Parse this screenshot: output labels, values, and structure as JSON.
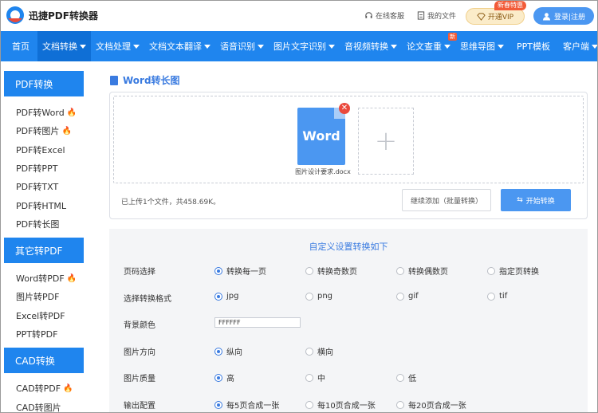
{
  "brand": {
    "name": "迅捷PDF转换器"
  },
  "header": {
    "online_service": "在线客服",
    "my_files": "我的文件",
    "vip_label": "开通VIP",
    "vip_badge": "新春特惠",
    "login_label": "登录|注册"
  },
  "nav": {
    "items": [
      "首页",
      "文档转换",
      "文档处理",
      "文档文本翻译",
      "语音识别",
      "图片文字识别",
      "音视频转换",
      "论文查重",
      "思维导图",
      "PPT模板",
      "客户端"
    ],
    "new_badge": "新"
  },
  "sidebar": {
    "groups": [
      {
        "title": "PDF转换",
        "items": [
          "PDF转Word",
          "PDF转图片",
          "PDF转Excel",
          "PDF转PPT",
          "PDF转TXT",
          "PDF转HTML",
          "PDF转长图"
        ]
      },
      {
        "title": "其它转PDF",
        "items": [
          "Word转PDF",
          "图片转PDF",
          "Excel转PDF",
          "PPT转PDF"
        ]
      },
      {
        "title": "CAD转换",
        "items": [
          "CAD转PDF",
          "CAD转图片"
        ]
      }
    ]
  },
  "main": {
    "title": "Word转长图",
    "file": {
      "icon_text": "Word",
      "name": "图片设计要求.docx"
    },
    "upload_info": "已上传1个文件，共458.69K。",
    "continue_btn": "继续添加（批量转换）",
    "start_btn": "开始转换",
    "settings": {
      "title": "自定义设置转换如下",
      "rows": [
        {
          "label": "页码选择",
          "options": [
            "转换每一页",
            "转换奇数页",
            "转换偶数页",
            "指定页转换"
          ],
          "selected": 0
        },
        {
          "label": "选择转换格式",
          "options": [
            "jpg",
            "png",
            "gif",
            "tif"
          ],
          "selected": 0
        },
        {
          "label": "背景颜色",
          "value": "FFFFFF"
        },
        {
          "label": "图片方向",
          "options": [
            "纵向",
            "横向"
          ],
          "selected": 0
        },
        {
          "label": "图片质量",
          "options": [
            "高",
            "中",
            "低"
          ],
          "selected": 0
        },
        {
          "label": "输出配置",
          "options": [
            "每5页合成一张",
            "每10页合成一张",
            "每20页合成一张"
          ],
          "selected": 0
        }
      ]
    }
  },
  "colors": {
    "primary": "#1f85ee",
    "accent": "#3a7be0",
    "fire": "#ff6a3c"
  }
}
